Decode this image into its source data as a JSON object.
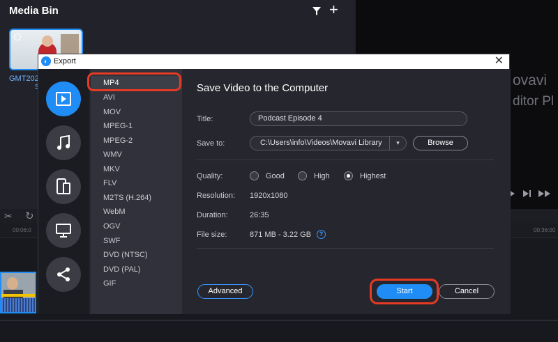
{
  "app": {
    "brand_line1": "ovavi",
    "brand_line2": "ditor Pl"
  },
  "media_bin": {
    "title": "Media Bin",
    "item_name_line1": "GMT202",
    "item_name_line2": "S",
    "filter_icon": "filter-icon",
    "add_icon": "plus-icon"
  },
  "timeline": {
    "ruler_left": "00:06:0",
    "ruler_right": "00:36:00"
  },
  "dialog": {
    "title": "Export",
    "close_icon": "close-icon",
    "categories": [
      {
        "name": "video",
        "icon": "play-icon",
        "active": true
      },
      {
        "name": "audio",
        "icon": "music-note-icon",
        "active": false
      },
      {
        "name": "devices",
        "icon": "devices-icon",
        "active": false
      },
      {
        "name": "tv",
        "icon": "monitor-icon",
        "active": false
      },
      {
        "name": "share",
        "icon": "share-icon",
        "active": false
      }
    ],
    "formats": [
      "MP4",
      "AVI",
      "MOV",
      "MPEG-1",
      "MPEG-2",
      "WMV",
      "MKV",
      "FLV",
      "M2TS (H.264)",
      "WebM",
      "OGV",
      "SWF",
      "DVD (NTSC)",
      "DVD (PAL)",
      "GIF"
    ],
    "selected_format": "MP4",
    "panel_title": "Save Video to the Computer",
    "title_label": "Title:",
    "title_value": "Podcast Episode 4",
    "save_to_label": "Save to:",
    "save_to_value": "C:\\Users\\info\\Videos\\Movavi Library",
    "browse_label": "Browse",
    "quality_label": "Quality:",
    "quality_options": [
      "Good",
      "High",
      "Highest"
    ],
    "quality_selected": "Highest",
    "resolution_label": "Resolution:",
    "resolution_value": "1920x1080",
    "duration_label": "Duration:",
    "duration_value": "26:35",
    "file_size_label": "File size:",
    "file_size_value": "871 MB - 3.22 GB",
    "help_glyph": "?",
    "advanced_label": "Advanced",
    "start_label": "Start",
    "cancel_label": "Cancel"
  },
  "colors": {
    "accent": "#1f8df5",
    "highlight": "#e73a24"
  }
}
